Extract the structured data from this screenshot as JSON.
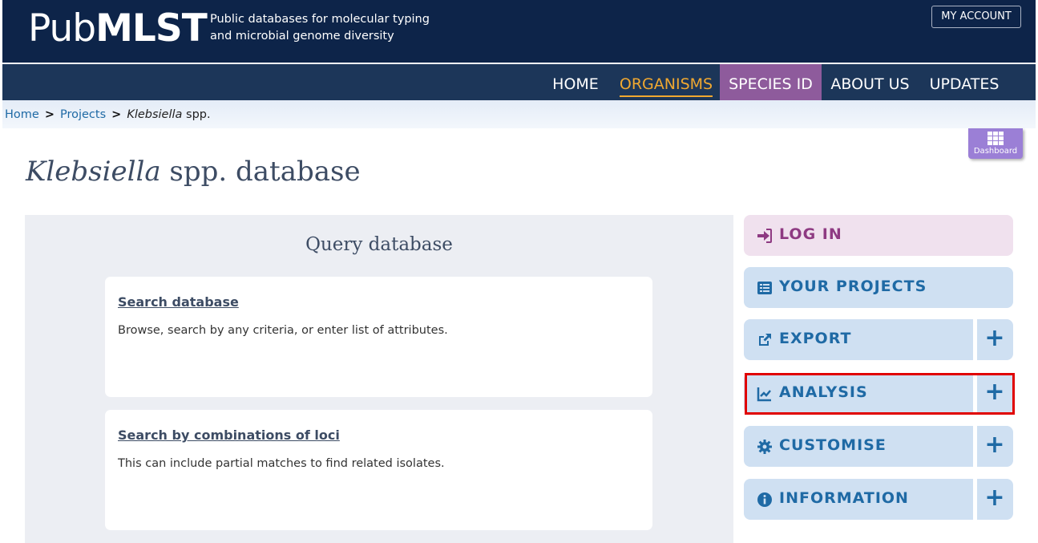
{
  "header": {
    "logo_light": "Pub",
    "logo_bold": "MLST",
    "tagline_line1": "Public databases for molecular typing",
    "tagline_line2": "and microbial genome diversity",
    "account_label": "MY ACCOUNT"
  },
  "nav": {
    "home": "HOME",
    "organisms": "ORGANISMS",
    "species_id": "SPECIES ID",
    "about_us": "ABOUT US",
    "updates": "UPDATES"
  },
  "breadcrumb": {
    "home": "Home",
    "projects": "Projects",
    "current_italic": "Klebsiella",
    "current_suffix": " spp.",
    "separator": ">"
  },
  "dashboard": {
    "label": "Dashboard"
  },
  "page": {
    "title_italic": "Klebsiella",
    "title_rest": " spp. database"
  },
  "query": {
    "title": "Query database",
    "cards": [
      {
        "title": "Search database",
        "desc": "Browse, search by any criteria, or enter list of attributes."
      },
      {
        "title": "Search by combinations of loci",
        "desc": "This can include partial matches to find related isolates."
      }
    ]
  },
  "sidebar": {
    "login": "LOG IN",
    "your_projects": "YOUR PROJECTS",
    "export": "EXPORT",
    "analysis": "ANALYSIS",
    "customise": "CUSTOMISE",
    "information": "INFORMATION",
    "expand_symbol": "+"
  },
  "colors": {
    "header_bg": "#0d2449",
    "nav_bg": "#1c3659",
    "active_nav": "#f0a830",
    "species_bg": "#8e5b9c",
    "side_btn_bg": "#cfe0f2",
    "login_bg": "#f0e1ee",
    "highlight": "#e00000"
  }
}
